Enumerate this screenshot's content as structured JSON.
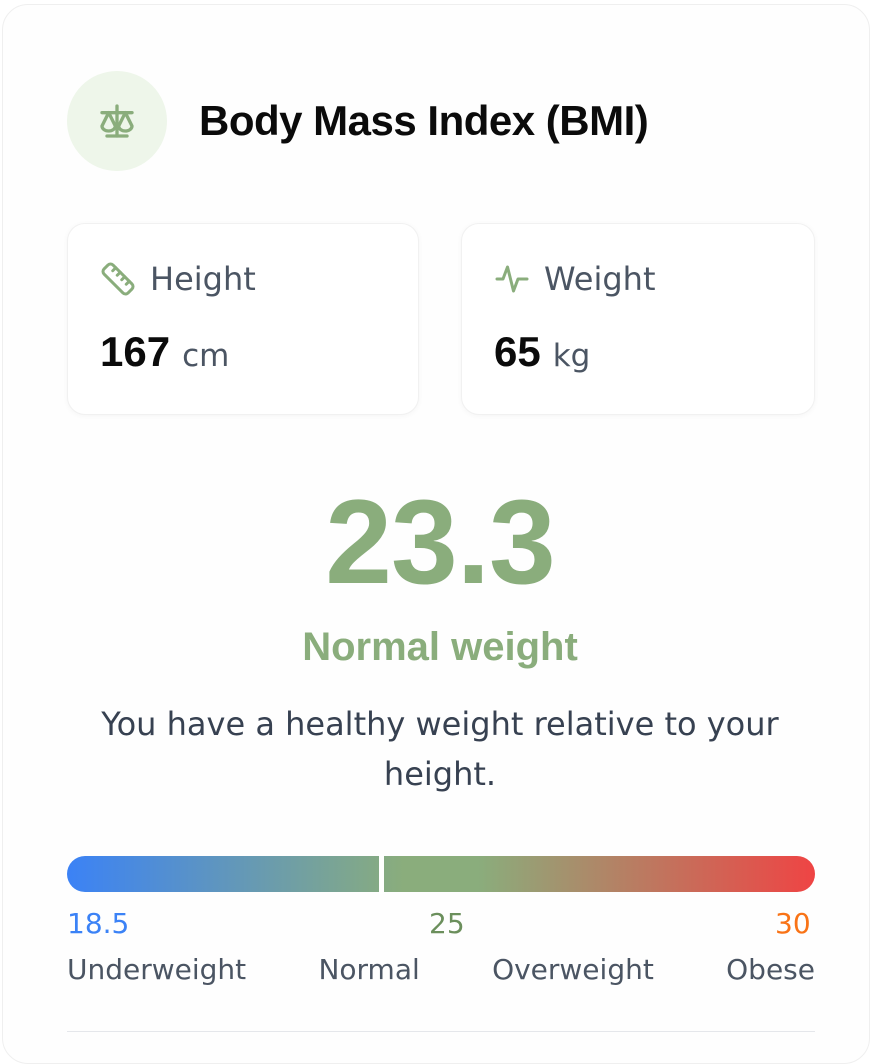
{
  "card": {
    "title": "Body Mass Index (BMI)",
    "title_icon": "scale-balance-icon"
  },
  "metrics": {
    "height": {
      "icon": "ruler-icon",
      "label": "Height",
      "value": "167",
      "unit": "cm"
    },
    "weight": {
      "icon": "activity-pulse-icon",
      "label": "Weight",
      "value": "65",
      "unit": "kg"
    }
  },
  "result": {
    "bmi": "23.3",
    "category": "Normal weight",
    "description": "You have a healthy weight relative to your height."
  },
  "scale": {
    "marker_position_fraction": 0.42,
    "thresholds": {
      "low": "18.5",
      "mid": "25",
      "high": "30"
    },
    "labels": [
      "Underweight",
      "Normal",
      "Overweight",
      "Obese"
    ]
  },
  "colors": {
    "accent": "#8aad7c",
    "accent_bg": "#eef6ea",
    "underweight": "#3b82f6",
    "obese": "#ef4444",
    "high_threshold": "#f97316"
  }
}
